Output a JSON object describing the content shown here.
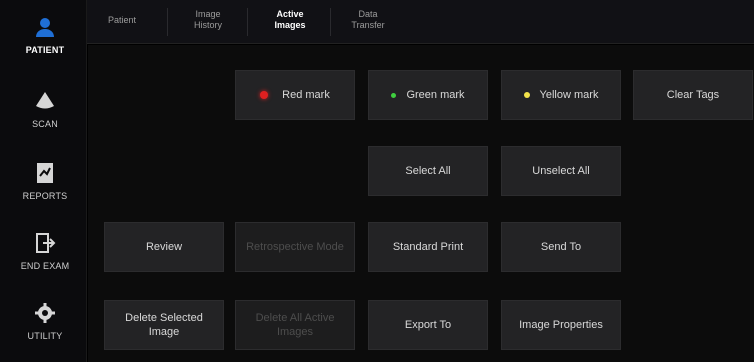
{
  "sidebar": {
    "items": [
      {
        "label": "PATIENT",
        "icon": "patient-icon",
        "active": true
      },
      {
        "label": "SCAN",
        "icon": "scan-icon",
        "active": false
      },
      {
        "label": "REPORTS",
        "icon": "reports-icon",
        "active": false
      },
      {
        "label": "END EXAM",
        "icon": "end-exam-icon",
        "active": false
      },
      {
        "label": "UTILITY",
        "icon": "gear-icon",
        "active": false
      }
    ]
  },
  "tabs": [
    {
      "label": "Patient",
      "active": false
    },
    {
      "label": "Image\nHistory",
      "active": false
    },
    {
      "label": "Active\nImages",
      "active": true
    },
    {
      "label": "Data\nTransfer",
      "active": false
    }
  ],
  "buttons": {
    "red_mark": "Red mark",
    "green_mark": "Green mark",
    "yellow_mark": "Yellow mark",
    "clear_tags": "Clear Tags",
    "select_all": "Select All",
    "unselect_all": "Unselect All",
    "review": "Review",
    "disabled_review": "Retrospective Mode",
    "standard_print": "Standard Print",
    "send_to": "Send To",
    "delete_selected_image": "Delete Selected Image",
    "delete_all": "Delete All Active Images",
    "export_to": "Export To",
    "image_properties": "Image Properties"
  },
  "colors": {
    "accent": "#1f6fd6",
    "red_mark": "#e02020",
    "green_mark": "#3fcf3f",
    "yellow_mark": "#f2e24a",
    "button_bg": "#232325"
  }
}
